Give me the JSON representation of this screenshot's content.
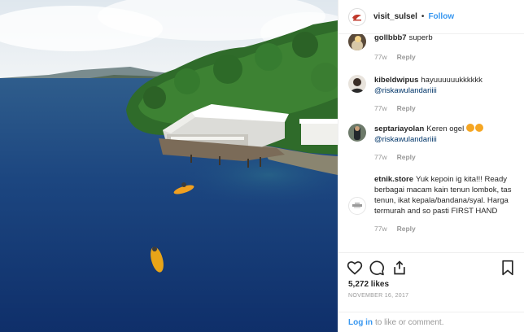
{
  "post": {
    "username": "visit_sulsel",
    "separator": "•",
    "follow_label": "Follow",
    "photo_icon": "aerial-lake-photo"
  },
  "comments": [
    {
      "user": "gollbbb7",
      "text": "superb",
      "mention": "",
      "time": "77w",
      "reply": "Reply"
    },
    {
      "user": "kibeldwipus",
      "text": "hayuuuuuukkkkkk",
      "mention": "@riskawulandariiii",
      "time": "77w",
      "reply": "Reply"
    },
    {
      "user": "septariayolan",
      "text": "Keren ogel",
      "mention": "@riskawulandariiii",
      "time": "77w",
      "reply": "Reply",
      "emojis": [
        "heart-eyes-emoji",
        "heart-eyes-emoji"
      ]
    },
    {
      "user": "etnik.store",
      "text": "Yuk kepoin ig kita!!! Ready berbagai macam kain tenun lombok, tas tenun, ikat kepala/bandana/syal. Harga termurah and so pasti FIRST HAND",
      "mention": "",
      "time": "77w",
      "reply": "Reply"
    }
  ],
  "actions": {
    "likes": "5,272 likes",
    "date": "NOVEMBER 16, 2017",
    "icons": [
      "heart-icon",
      "comment-icon",
      "share-icon",
      "bookmark-icon"
    ]
  },
  "login": {
    "link": "Log in",
    "text": "to like or comment."
  }
}
